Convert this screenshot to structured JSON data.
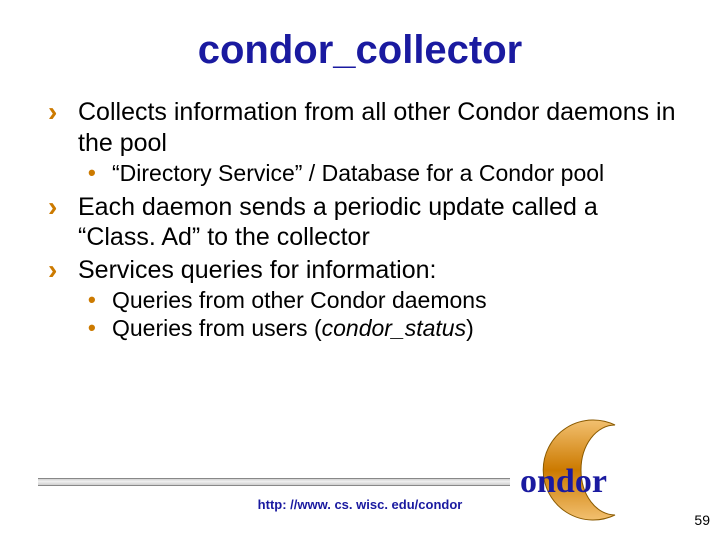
{
  "title": "condor_collector",
  "bullets": [
    {
      "text": "Collects information from all other Condor daemons in the pool",
      "sub": [
        {
          "text": "“Directory Service” / Database for a Condor pool"
        }
      ]
    },
    {
      "text": "Each daemon sends a periodic update called a “Class. Ad” to the collector",
      "sub": []
    },
    {
      "text": "Services queries for information:",
      "sub": [
        {
          "text": "Queries from other Condor daemons"
        },
        {
          "prefix": "Queries from users (",
          "italic": "condor_status",
          "suffix": ")"
        }
      ]
    }
  ],
  "footer_url": "http: //www. cs. wisc. edu/condor",
  "page_number": "59",
  "logo_text": "Condor",
  "brand_color": "#cc7a00"
}
